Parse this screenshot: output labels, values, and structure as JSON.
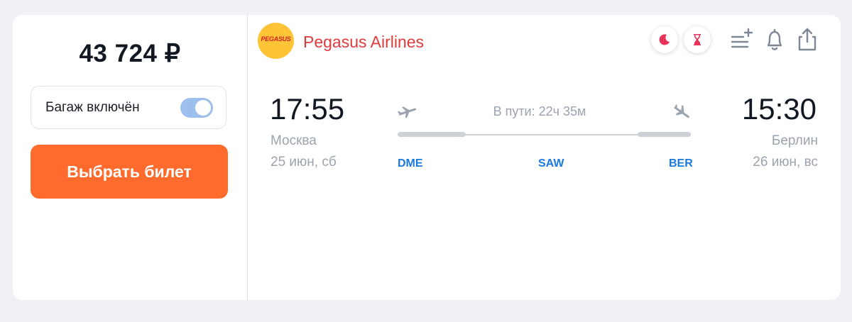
{
  "price": "43 724 ₽",
  "baggage": {
    "label": "Багаж включён",
    "enabled": true
  },
  "select_button": "Выбрать билет",
  "airline": {
    "name": "Pegasus Airlines",
    "logo_text": "PEGASUS"
  },
  "badges": [
    "moon-icon",
    "hourglass-icon"
  ],
  "actions": [
    "add-to-list-icon",
    "bell-icon",
    "share-icon"
  ],
  "flight": {
    "departure": {
      "time": "17:55",
      "city": "Москва",
      "date": "25 июн, сб",
      "airport": "DME"
    },
    "arrival": {
      "time": "15:30",
      "city": "Берлин",
      "date": "26 июн, вс",
      "airport": "BER"
    },
    "transfer_airport": "SAW",
    "duration": "В пути: 22ч 35м"
  },
  "colors": {
    "accent_orange": "#ff6b2c",
    "airline_red": "#e03a3a",
    "airport_blue": "#1b7ae0",
    "toggle_blue": "#9cbfef",
    "badge_pink": "#e8345a"
  }
}
